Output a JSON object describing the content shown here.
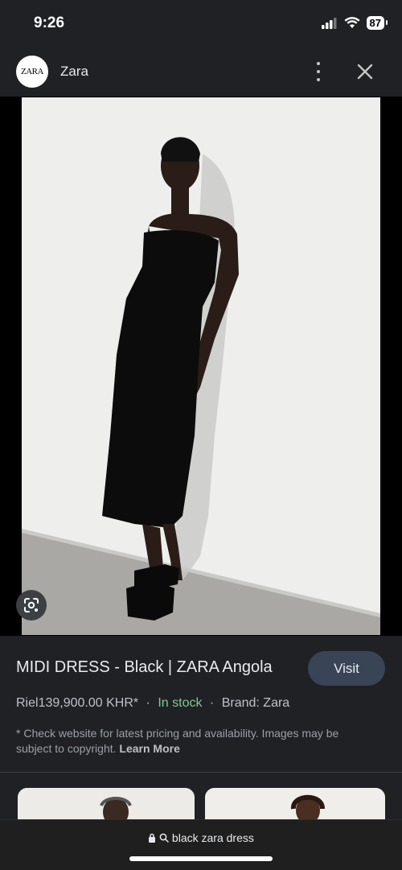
{
  "status": {
    "time": "9:26",
    "battery": "87"
  },
  "header": {
    "logo_text": "ZARA",
    "site_name": "Zara"
  },
  "product": {
    "title": "MIDI DRESS - Black | ZARA Angola",
    "price": "Riel139,900.00 KHR*",
    "sep1": "·",
    "stock": "In stock",
    "sep2": "·",
    "brand": "Brand: Zara",
    "visit_label": "Visit"
  },
  "disclaimer": {
    "text": "* Check website for latest pricing and availability. Images may be subject to copyright.",
    "link": "Learn More"
  },
  "address_bar": {
    "query": "black zara dress"
  },
  "icons": {
    "more": "more-vert-icon",
    "close": "close-icon",
    "lens": "google-lens-icon",
    "lock": "lock-icon",
    "search": "search-icon"
  },
  "colors": {
    "in_stock": "#81c995",
    "visit_button": "#394457",
    "background": "#202124"
  }
}
